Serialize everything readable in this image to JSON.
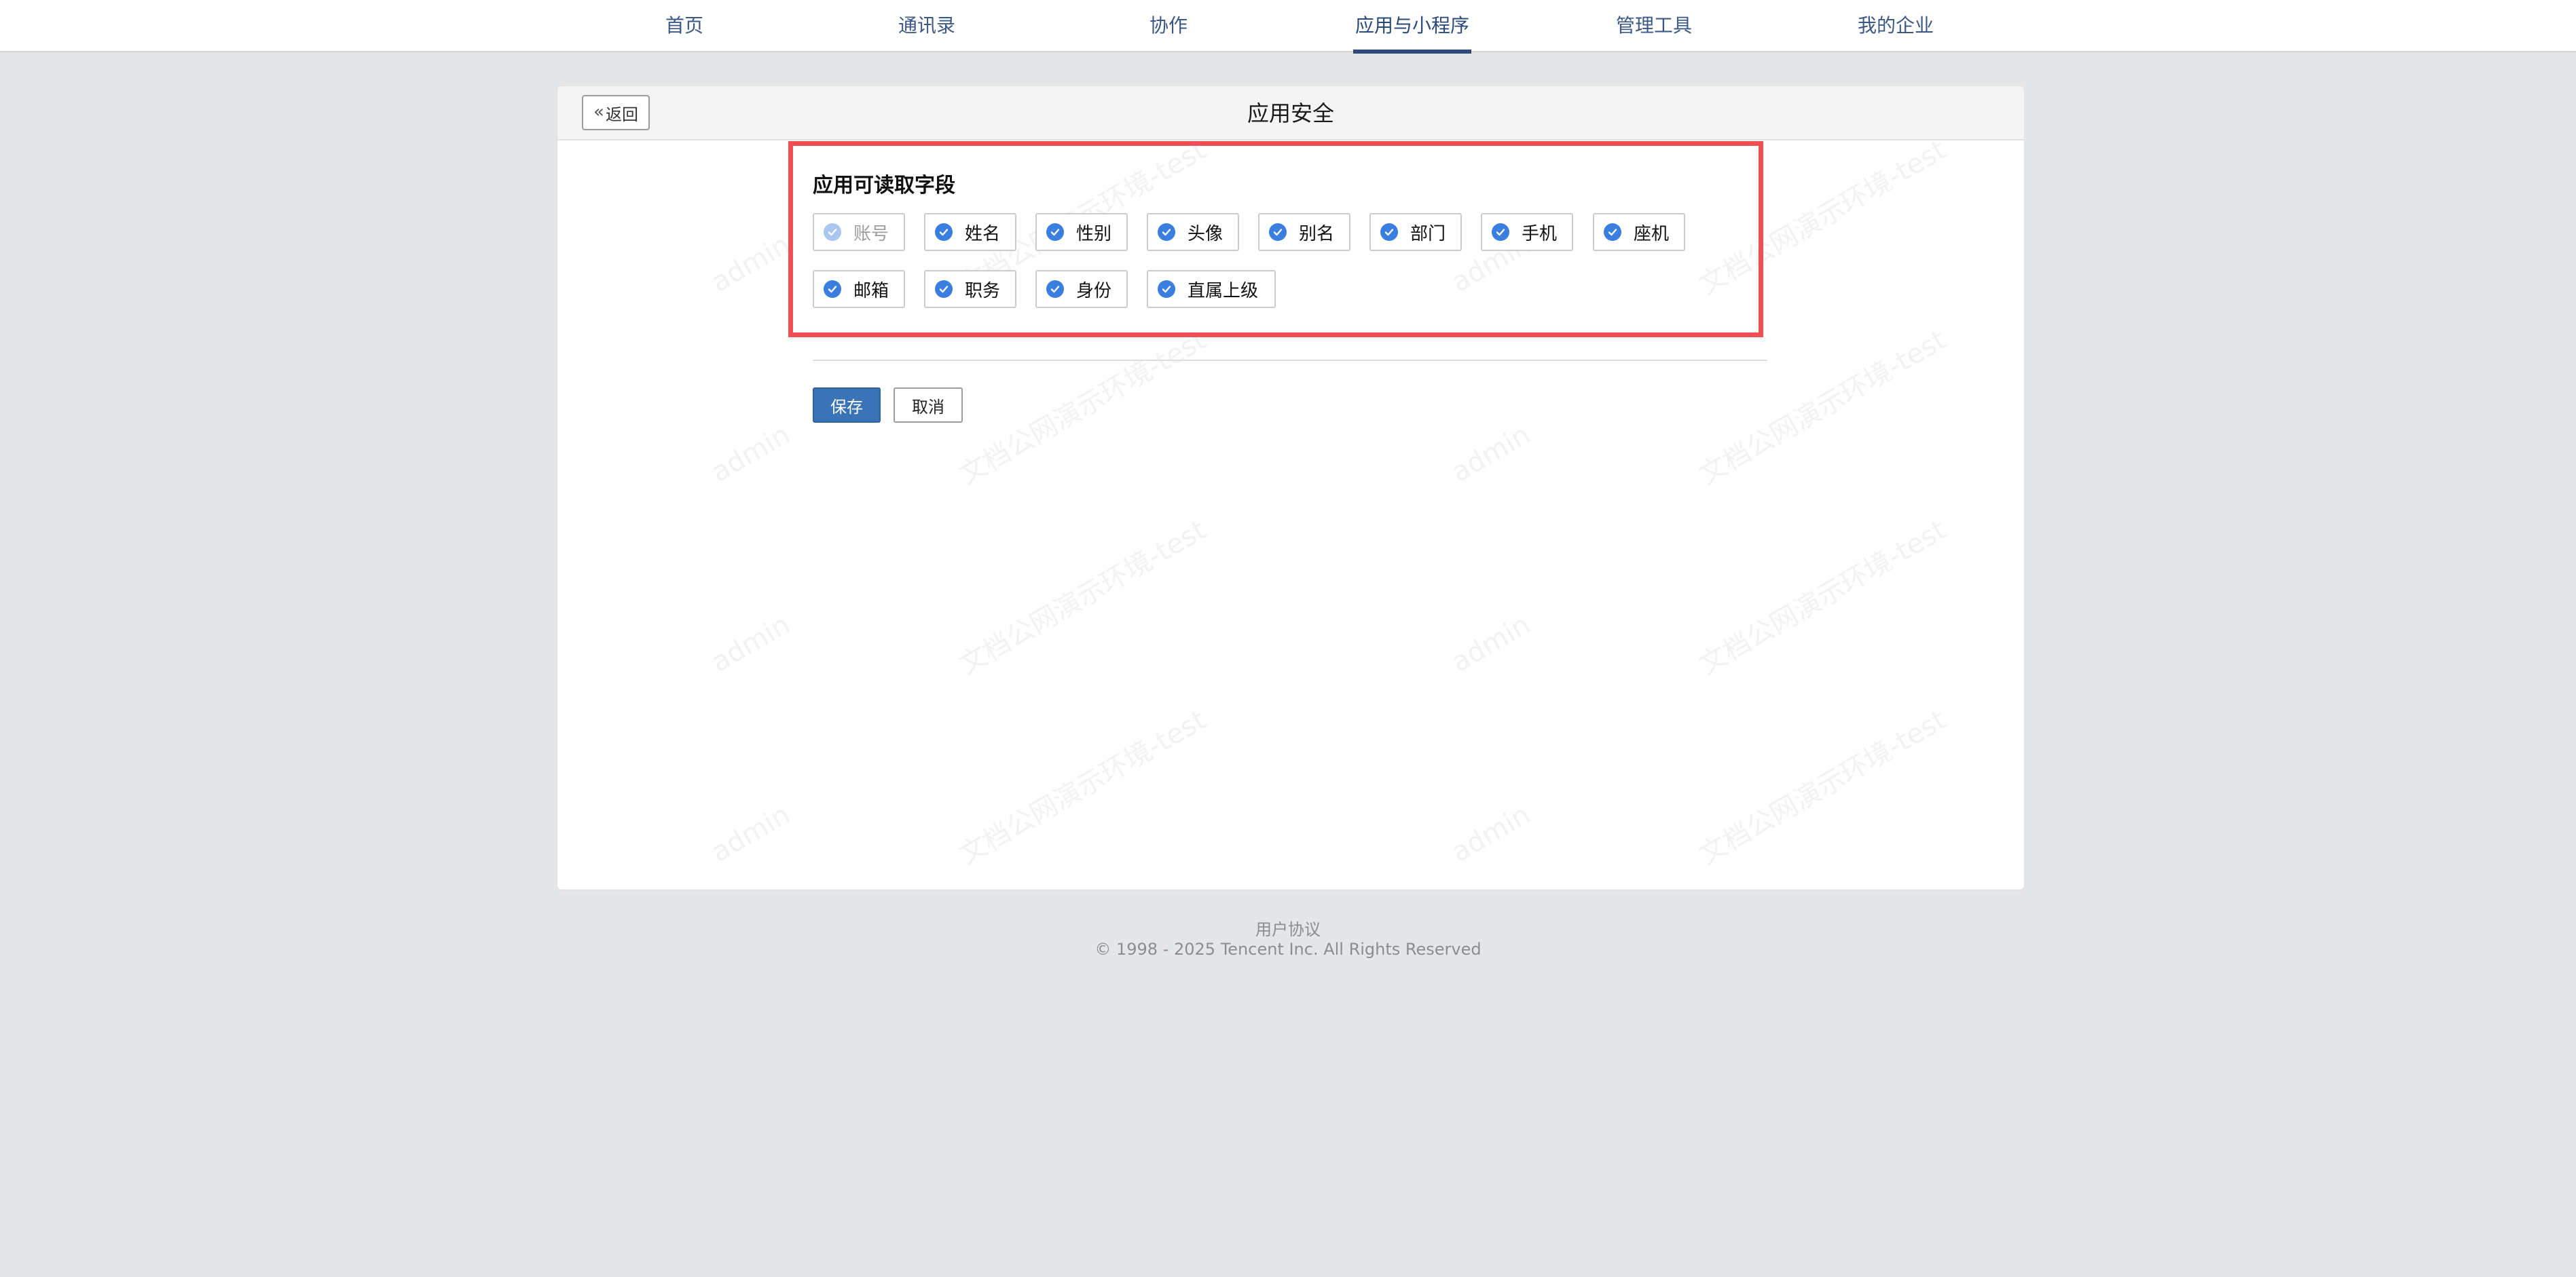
{
  "nav": {
    "items": [
      {
        "label": "首页"
      },
      {
        "label": "通讯录"
      },
      {
        "label": "协作"
      },
      {
        "label": "应用与小程序",
        "active": true
      },
      {
        "label": "管理工具"
      },
      {
        "label": "我的企业"
      }
    ]
  },
  "panel": {
    "back_label": "返回",
    "title": "应用安全"
  },
  "fields_section": {
    "title": "应用可读取字段",
    "fields": [
      {
        "label": "账号",
        "checked": true,
        "disabled": true
      },
      {
        "label": "姓名",
        "checked": true
      },
      {
        "label": "性别",
        "checked": true
      },
      {
        "label": "头像",
        "checked": true
      },
      {
        "label": "别名",
        "checked": true
      },
      {
        "label": "部门",
        "checked": true
      },
      {
        "label": "手机",
        "checked": true
      },
      {
        "label": "座机",
        "checked": true
      },
      {
        "label": "邮箱",
        "checked": true
      },
      {
        "label": "职务",
        "checked": true
      },
      {
        "label": "身份",
        "checked": true
      },
      {
        "label": "直属上级",
        "checked": true
      }
    ]
  },
  "actions": {
    "save_label": "保存",
    "cancel_label": "取消"
  },
  "watermark": {
    "user": "admin",
    "org": "文档公网演示环境-test"
  },
  "footer": {
    "agreement": "用户协议",
    "copyright": "© 1998 - 2025 Tencent Inc. All Rights Reserved"
  },
  "colors": {
    "accent": "#3a7ee0",
    "primary_button": "#3a73b6",
    "highlight": "#ef4f55",
    "nav_text": "#3c5886"
  }
}
